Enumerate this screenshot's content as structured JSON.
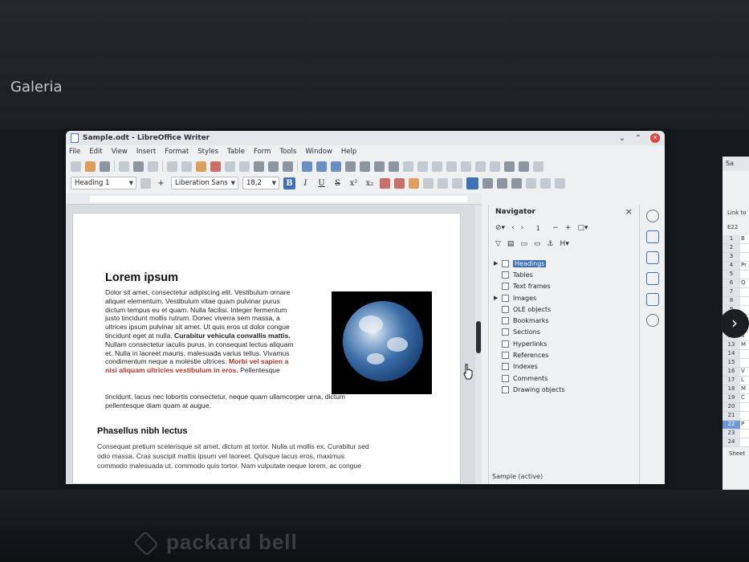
{
  "gallery": {
    "label": "Galeria"
  },
  "brand": {
    "text": "packard bell"
  },
  "window": {
    "title": "Sample.odt - LibreOffice Writer",
    "menu": [
      "File",
      "Edit",
      "View",
      "Insert",
      "Format",
      "Styles",
      "Table",
      "Form",
      "Tools",
      "Window",
      "Help"
    ],
    "paragraph_style": "Heading 1",
    "font_name": "Liberation Sans",
    "font_size": "18,2",
    "format_buttons": {
      "bold": "B",
      "italic": "I",
      "underline": "U",
      "strike": "S",
      "superscript": "x²",
      "subscript": "x₂"
    }
  },
  "document": {
    "heading1": "Lorem ipsum",
    "para1_lines": [
      "Dolor sit amet, consectetur adipiscing elit. Vestibulum ornare",
      "aliquet elementum. Vestibulum vitae quam pulvinar purus",
      "dictum tempus eu et quam. Nulla facilisi. Integer fermentum",
      "justo tincidunt mollis rutrum. Donec viverra sem massa, a",
      "ultrices ipsum pulvinar sit amet. Ut quis eros ut dolor congue"
    ],
    "para1_line6_plain": "tincidunt eget at nulla. ",
    "para1_line6_bold": "Curabitur vehicula convallis mattis.",
    "para1_lines_b": [
      "Nullam consectetur iaculis purus, in consequat lectus aliquam",
      "et. Nulla in laoreet mauris, malesuada varius tellus. Vivamus"
    ],
    "para1_line9_plain": "condimentum neque a molestie ultrices. ",
    "para1_line9_red": "Morbi vel sapien a",
    "para1_line10_red": "nisi aliquam ultricies vestibulum in eros.",
    "para1_line10_plain": " Pellentesque",
    "para1_tail_lines": [
      "tincidunt, lacus nec lobortis consectetur, neque quam ullamcorper urna, dictum",
      "pellentesque diam quam at augue."
    ],
    "heading2": "Phasellus nibh lectus",
    "para2_lines": [
      "Consequat pretium scelerisque sit amet, dictum at tortor. Nulla ut mollis ex. Curabitur sed",
      "odio massa. Cras suscipit mattis ipsum vel laoreet. Quisque lacus eros, maximus",
      "commodo malesuada ut, commodo quis tortor. Nam vulputate neque lorem, ac congue"
    ]
  },
  "navigator": {
    "title": "Navigator",
    "page_number": "1",
    "items": [
      {
        "label": "Headings",
        "expandable": true,
        "selected": true
      },
      {
        "label": "Tables",
        "expandable": false,
        "selected": false
      },
      {
        "label": "Text frames",
        "expandable": false,
        "selected": false
      },
      {
        "label": "Images",
        "expandable": true,
        "selected": false
      },
      {
        "label": "OLE objects",
        "expandable": false,
        "selected": false
      },
      {
        "label": "Bookmarks",
        "expandable": false,
        "selected": false
      },
      {
        "label": "Sections",
        "expandable": false,
        "selected": false
      },
      {
        "label": "Hyperlinks",
        "expandable": false,
        "selected": false
      },
      {
        "label": "References",
        "expandable": false,
        "selected": false
      },
      {
        "label": "Indexes",
        "expandable": false,
        "selected": false
      },
      {
        "label": "Comments",
        "expandable": false,
        "selected": false
      },
      {
        "label": "Drawing objects",
        "expandable": false,
        "selected": false
      }
    ],
    "status": "Sample (active)"
  },
  "background_window": {
    "title": "Sa",
    "link_label": "Link to",
    "cell_ref": "E22",
    "rows": [
      {
        "n": "1",
        "c": "B"
      },
      {
        "n": "2",
        "c": ""
      },
      {
        "n": "3",
        "c": ""
      },
      {
        "n": "4",
        "c": "Pr"
      },
      {
        "n": "5",
        "c": ""
      },
      {
        "n": "6",
        "c": "Q"
      },
      {
        "n": "7",
        "c": ""
      },
      {
        "n": "8",
        "c": ""
      },
      {
        "n": "9",
        "c": ""
      },
      {
        "n": "10",
        "c": ""
      },
      {
        "n": "11",
        "c": "B"
      },
      {
        "n": "12",
        "c": "S"
      },
      {
        "n": "13",
        "c": "M"
      },
      {
        "n": "14",
        "c": ""
      },
      {
        "n": "15",
        "c": ""
      },
      {
        "n": "16",
        "c": "V"
      },
      {
        "n": "17",
        "c": "L"
      },
      {
        "n": "18",
        "c": "M"
      },
      {
        "n": "19",
        "c": "C"
      },
      {
        "n": "20",
        "c": ""
      },
      {
        "n": "21",
        "c": ""
      },
      {
        "n": "22",
        "c": "P"
      },
      {
        "n": "23",
        "c": ""
      },
      {
        "n": "24",
        "c": ""
      }
    ],
    "highlighted_row": "22",
    "sheet_tab": "Sheet"
  }
}
